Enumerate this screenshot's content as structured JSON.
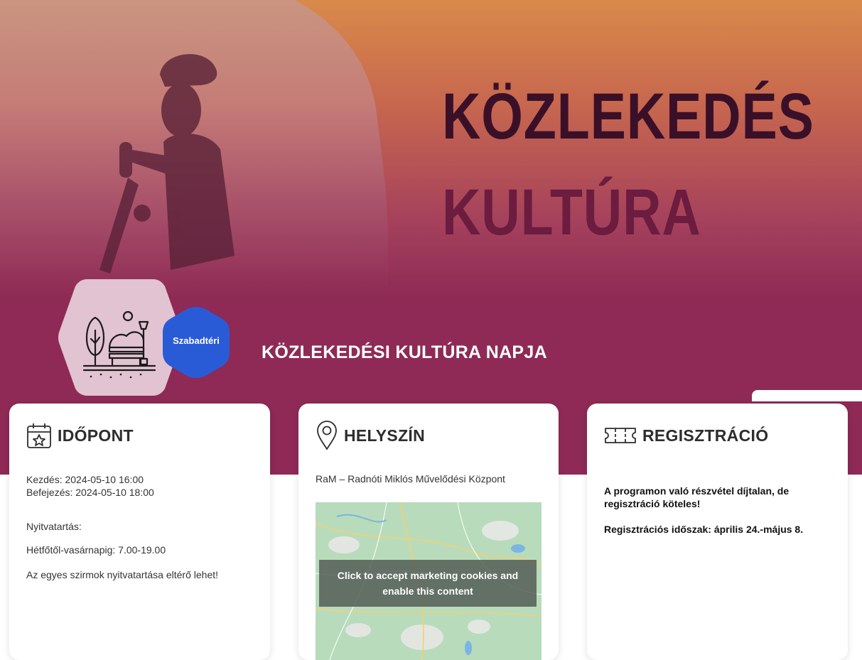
{
  "hero": {
    "title_line1": "KÖZLEKEDÉS",
    "title_line2": "KULTÚRA",
    "event_title": "KÖZLEKEDÉSI KULTÚRA NAPJA",
    "category_badge": "Szabadtéri"
  },
  "cards": {
    "time": {
      "title": "IDŐPONT",
      "icon": "calendar-star-icon",
      "start": "Kezdés: 2024-05-10 16:00",
      "end": "Befejezés: 2024-05-10 18:00",
      "opening_label": "Nyitvatartás:",
      "opening_hours": "Hétfőtől-vasárnapig: 7.00-19.00",
      "note": "Az egyes szirmok nyitvatartása eltérő lehet!"
    },
    "location": {
      "title": "HELYSZÍN",
      "icon": "map-pin-icon",
      "venue": "RaM – Radnóti Miklós Művelődési Központ",
      "map_overlay": "Click to accept marketing cookies and enable this content"
    },
    "registration": {
      "title": "REGISZTRÁCIÓ",
      "icon": "ticket-icon",
      "text1": "A programon való részvétel díjtalan, de regisztráció köteles!",
      "text2": "Regisztrációs időszak: április 24.-május 8."
    }
  },
  "colors": {
    "hero_bg": "#8e2a55",
    "accent_orange": "#d5874d",
    "badge_blue": "#2a5bd7",
    "hex_pink": "#e2c3d1"
  }
}
